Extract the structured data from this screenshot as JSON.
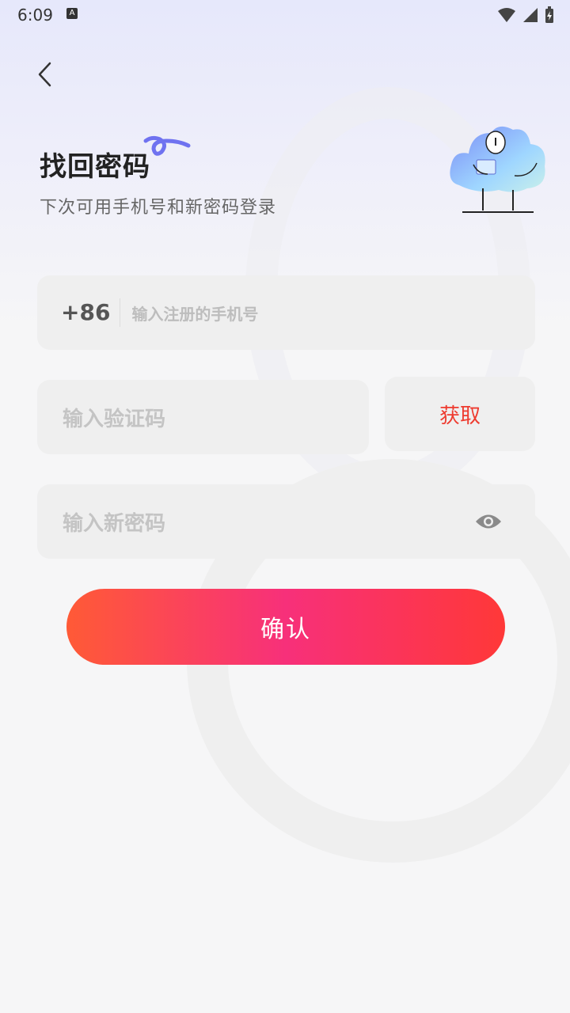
{
  "status": {
    "time": "6:09",
    "badge": "A"
  },
  "header": {
    "title": "找回密码",
    "subtitle": "下次可用手机号和新密码登录"
  },
  "form": {
    "country_code": "+86",
    "phone_placeholder": "输入注册的手机号",
    "code_placeholder": "输入验证码",
    "get_code_label": "获取",
    "password_placeholder": "输入新密码"
  },
  "confirm_label": "确认",
  "colors": {
    "accent": "#ee3b2f",
    "button_start": "#ff5a36",
    "button_mid": "#f7307a",
    "button_end": "#ff3838"
  },
  "icons": [
    "back-arrow-icon",
    "eye-icon",
    "wifi-icon",
    "signal-icon",
    "battery-icon"
  ]
}
